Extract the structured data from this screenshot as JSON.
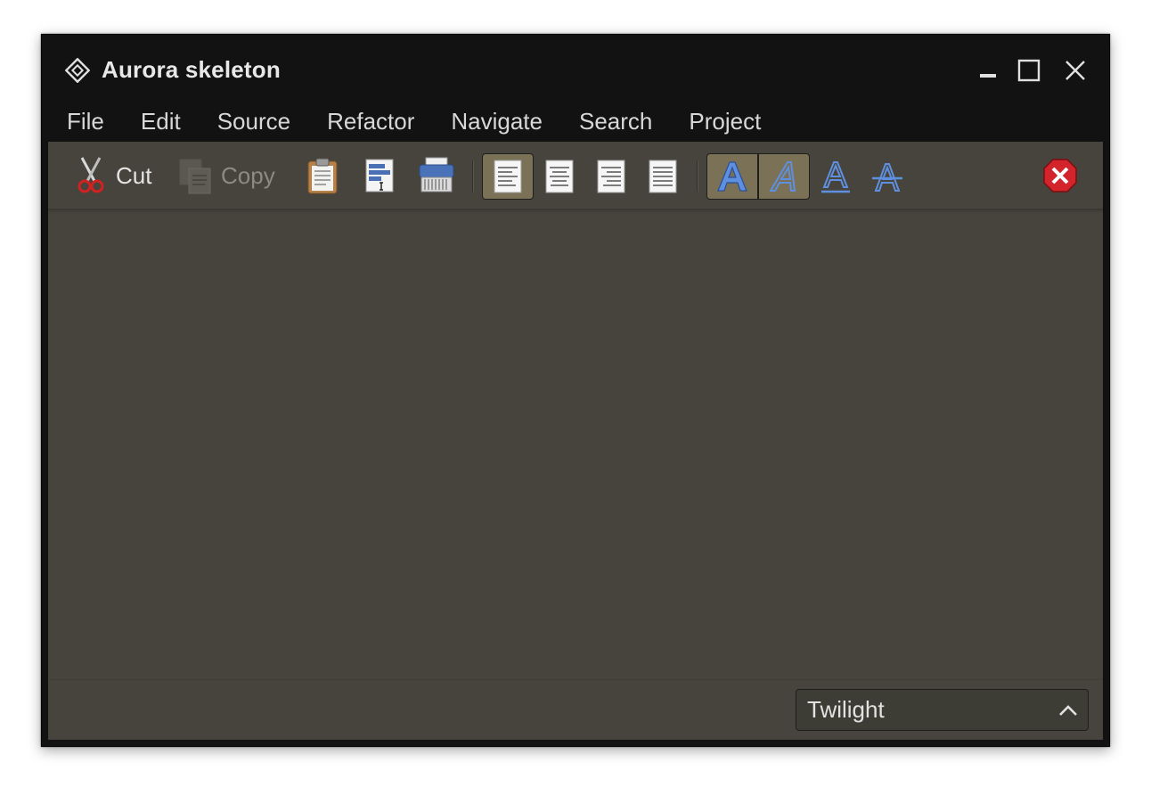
{
  "window": {
    "title": "Aurora skeleton"
  },
  "menu": {
    "items": [
      "File",
      "Edit",
      "Source",
      "Refactor",
      "Navigate",
      "Search",
      "Project"
    ]
  },
  "toolbar": {
    "cut_label": "Cut",
    "copy_label": "Copy",
    "copy_enabled": false,
    "alignment_selected": "left",
    "format_bold_active": true,
    "format_italic_active": true
  },
  "status": {
    "theme_value": "Twilight"
  },
  "colors": {
    "chrome": "#121212",
    "body": "#46443c",
    "toggle_on": "#7a7156"
  }
}
